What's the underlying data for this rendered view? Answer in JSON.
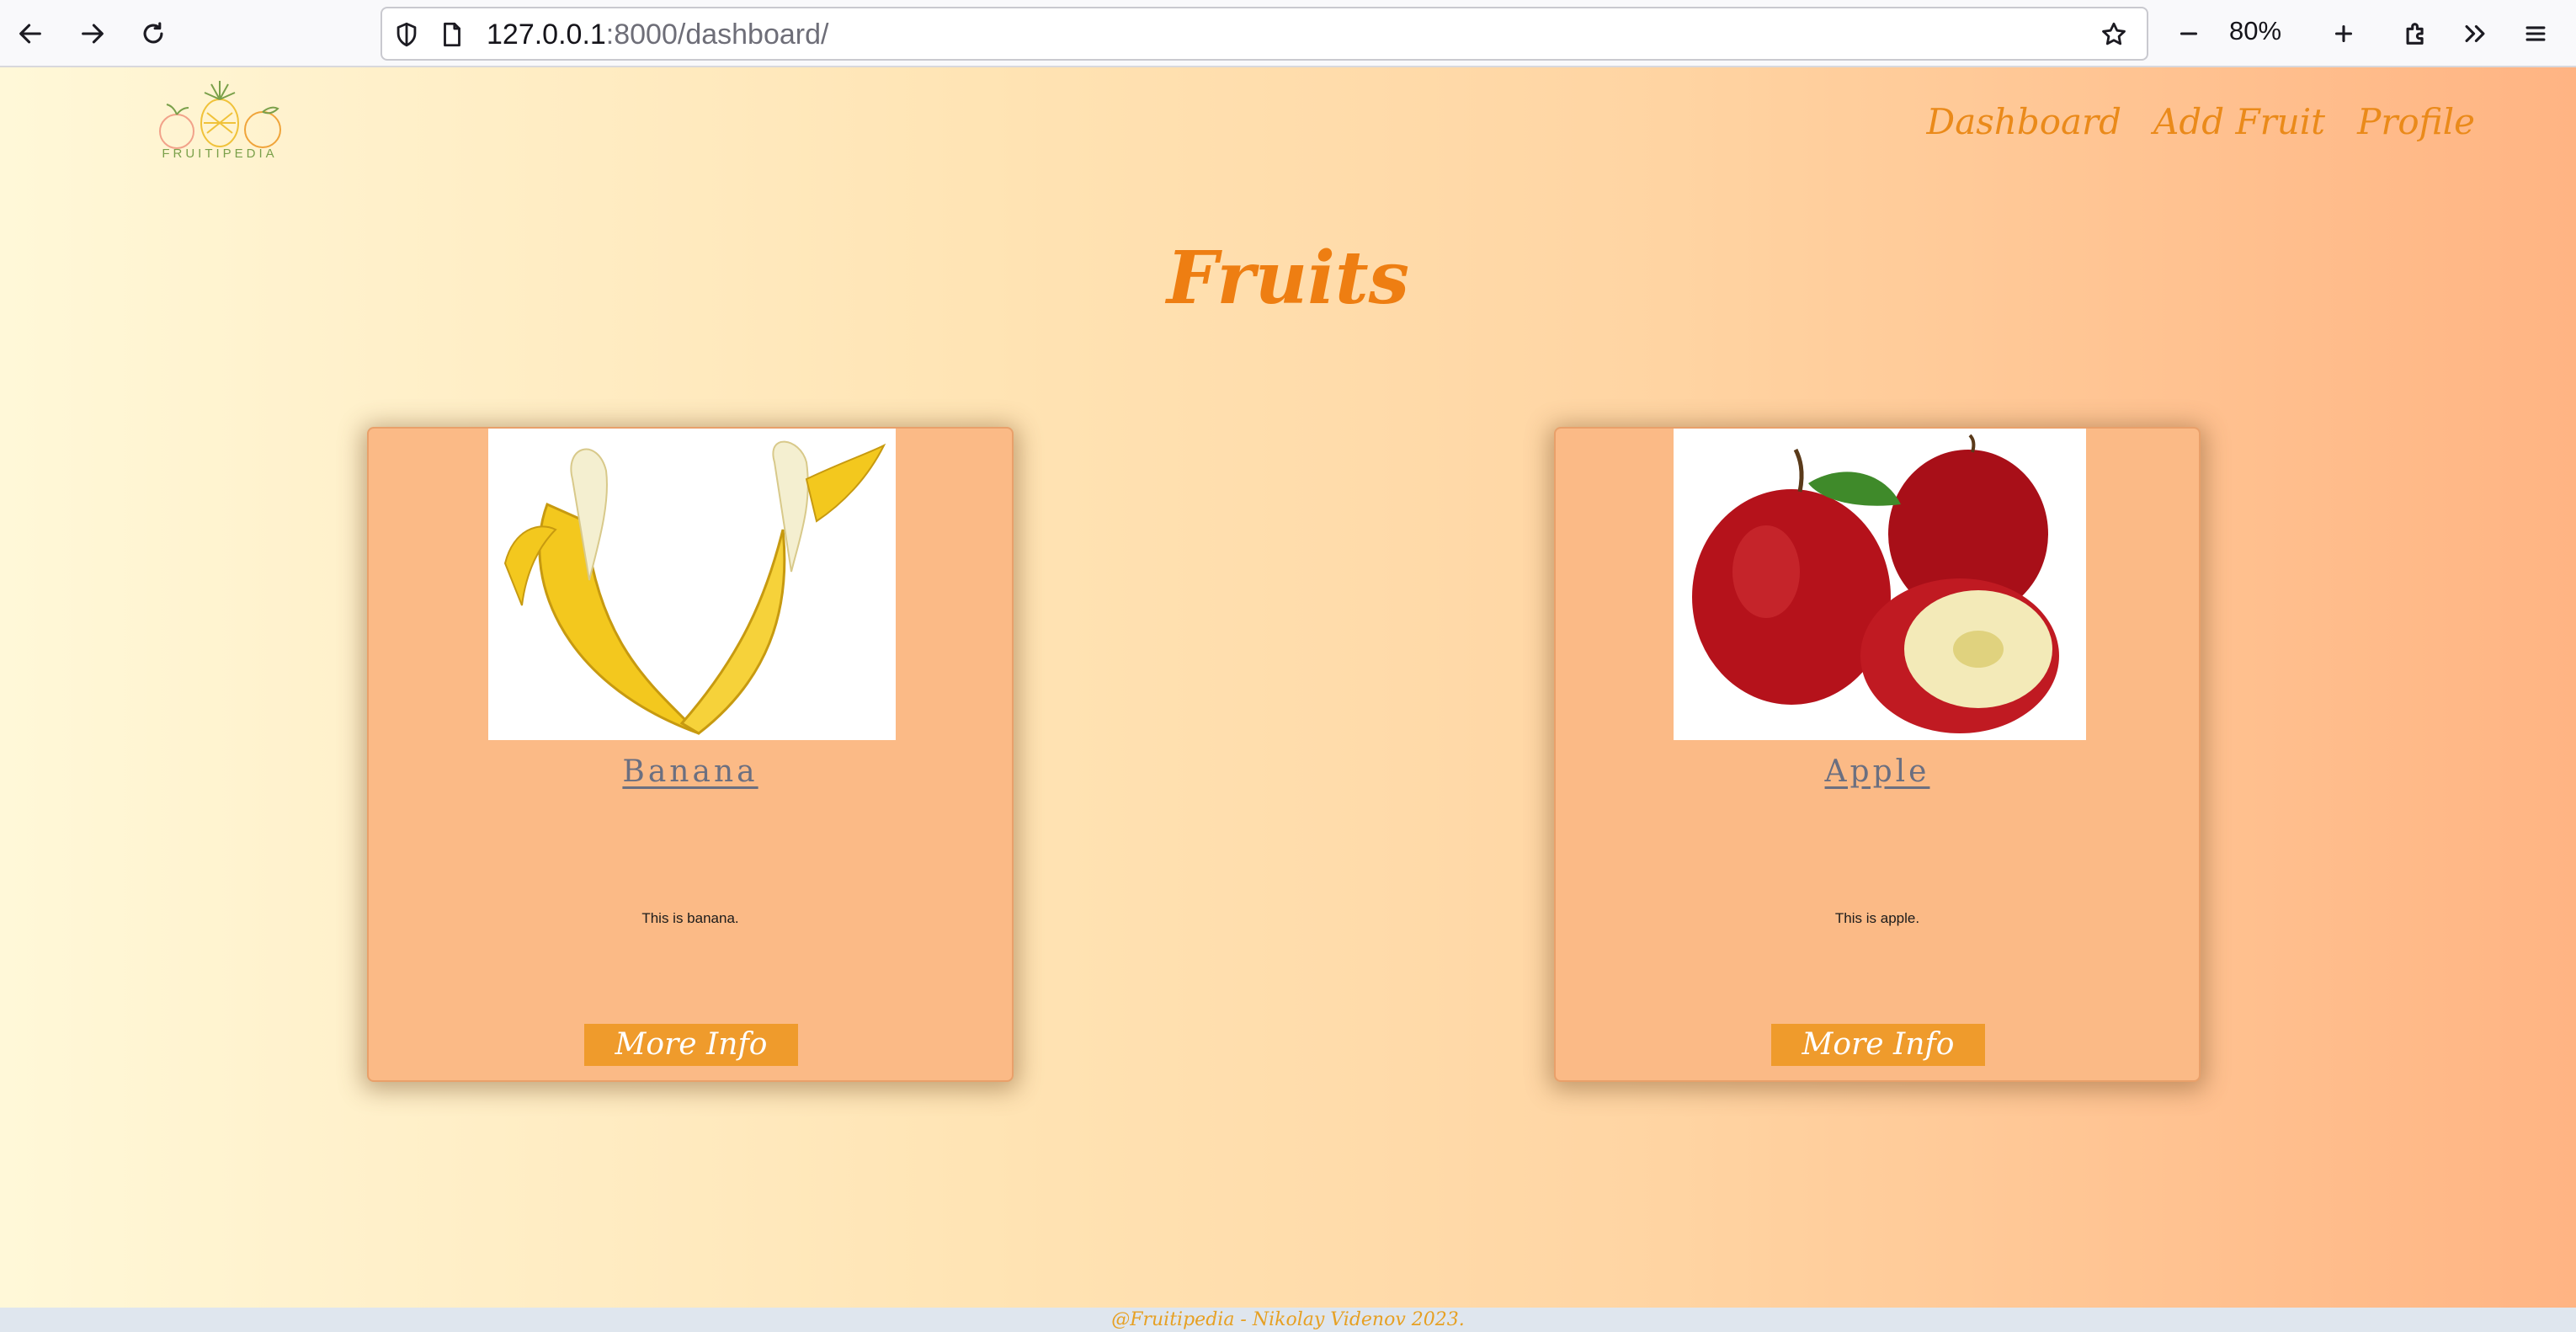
{
  "browser": {
    "url_host": "127.0.0.1",
    "url_path": ":8000/dashboard/",
    "zoom": "80%",
    "icons": {
      "back": "arrow-left-icon",
      "forward": "arrow-right-icon",
      "reload": "reload-icon",
      "shield": "shield-icon",
      "page": "page-icon",
      "bookmark": "star-icon",
      "zoom_out": "minus-icon",
      "zoom_in": "plus-icon",
      "extensions": "puzzle-icon",
      "overflow": "chevrons-right-icon",
      "menu": "hamburger-menu-icon"
    }
  },
  "site": {
    "logo_text": "FRUITIPEDIA",
    "nav": [
      "Dashboard",
      "Add Fruit",
      "Profile"
    ],
    "title": "Fruits",
    "footer": "@Fruitipedia - Nikolay Videnov 2023."
  },
  "fruits": [
    {
      "name": "Banana",
      "description": "This is banana.",
      "button": "More Info"
    },
    {
      "name": "Apple",
      "description": "This is apple.",
      "button": "More Info"
    }
  ],
  "colors": {
    "accent": "#ee7e12",
    "card_bg": "#fbba86",
    "button_bg": "#ef9b2c"
  }
}
